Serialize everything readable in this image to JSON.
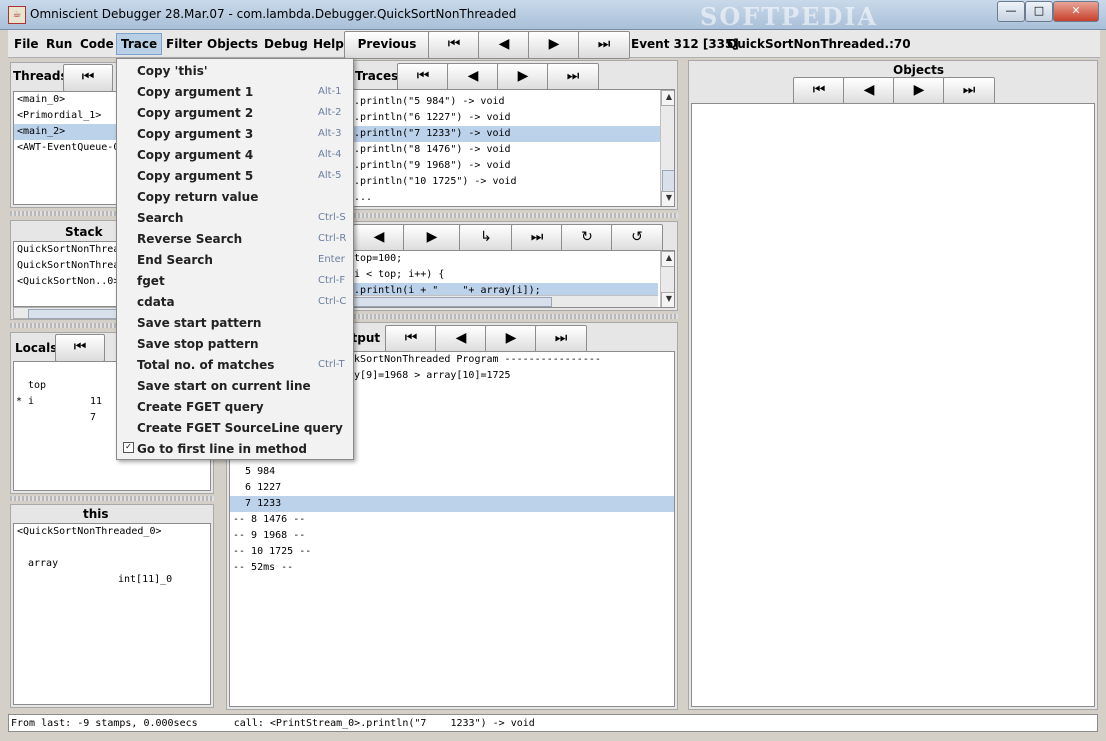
{
  "window": {
    "title": "Omniscient Debugger 28.Mar.07 - com.lambda.Debugger.QuickSortNonThreaded",
    "watermark": "SOFTPEDIA",
    "minimize": "—",
    "maximize": "□",
    "close": "✕"
  },
  "menu": {
    "items": [
      "File",
      "Run",
      "Code",
      "Trace",
      "Filter",
      "Objects",
      "Debug",
      "Help"
    ],
    "active": "Trace"
  },
  "toolbar": {
    "previous_label": "Previous",
    "event_label": "Event 312 [335]",
    "location_label": "QuickSortNonThreaded.:70"
  },
  "icons": {
    "first": "⏮",
    "prev": "◀",
    "next": "▶",
    "last": "⏭",
    "step_into": "↳",
    "redo": "↻",
    "undo": "↺"
  },
  "panels": {
    "threads": {
      "title": "Threads",
      "items": [
        "<main_0>",
        "<Primordial_1>",
        "<main_2>",
        "<AWT-EventQueue-0>"
      ],
      "selected": 2
    },
    "stack": {
      "title": "Stack",
      "items": [
        "QuickSortNonThreaded",
        "QuickSortNonThrea",
        "<QuickSortNon..0>"
      ]
    },
    "locals": {
      "title": "Locals",
      "rows": [
        {
          "name": "top",
          "value": "11"
        },
        {
          "name": "* i",
          "value": "7"
        }
      ]
    },
    "this": {
      "title": "this",
      "header": "<QuickSortNonThreaded_0>",
      "rows": [
        {
          "name": "array",
          "value": "int[11]_0"
        }
      ]
    },
    "traces": {
      "title": "Traces",
      "rows": [
        ".println(\"5 984\") -> void",
        ".println(\"6 1227\") -> void",
        ".println(\"7 1233\") -> void",
        ".println(\"8 1476\") -> void",
        ".println(\"9 1968\") -> void",
        ".println(\"10 1725\") -> void",
        "..."
      ],
      "selected": 2
    },
    "code": {
      "rows": [
        ") top=100;",
        "  i < top; i++) {",
        "ut.println(i + \"    \"+ array[i]);"
      ],
      "selected": 2
    },
    "output": {
      "title": "utput",
      "rows": [
        "ickSortNonThreaded Program ----------------",
        "ray[9]=1968 > array[10]=1725",
        "",
        "",
        "",
        "",
        "",
        "  5 984",
        "  6 1227",
        "  7 1233",
        "-- 8 1476 --",
        "-- 9 1968 --",
        "-- 10 1725 --",
        "-- 52ms --"
      ],
      "selected": 9
    },
    "objects": {
      "title": "Objects"
    }
  },
  "trace_menu": [
    {
      "label": "Copy 'this'",
      "accel": ""
    },
    {
      "label": "Copy argument 1",
      "accel": "Alt-1"
    },
    {
      "label": "Copy argument 2",
      "accel": "Alt-2"
    },
    {
      "label": "Copy argument 3",
      "accel": "Alt-3"
    },
    {
      "label": "Copy argument 4",
      "accel": "Alt-4"
    },
    {
      "label": "Copy argument 5",
      "accel": "Alt-5"
    },
    {
      "label": "Copy return value",
      "accel": ""
    },
    {
      "label": "Search",
      "accel": "Ctrl-S"
    },
    {
      "label": "Reverse Search",
      "accel": "Ctrl-R"
    },
    {
      "label": "End Search",
      "accel": "Enter"
    },
    {
      "label": "fget",
      "accel": "Ctrl-F"
    },
    {
      "label": "cdata",
      "accel": "Ctrl-C"
    },
    {
      "label": "Save start pattern",
      "accel": ""
    },
    {
      "label": "Save stop pattern",
      "accel": ""
    },
    {
      "label": "Total no. of matches",
      "accel": "Ctrl-T"
    },
    {
      "label": "Save start on current line",
      "accel": ""
    },
    {
      "label": "Create FGET query",
      "accel": ""
    },
    {
      "label": "Create FGET SourceLine query",
      "accel": ""
    },
    {
      "label": "Go to first line in method",
      "accel": "",
      "checked": true
    }
  ],
  "status": {
    "text": "From last: -9 stamps, 0.000secs      call: <PrintStream_0>.println(\"7    1233\") -> void"
  }
}
